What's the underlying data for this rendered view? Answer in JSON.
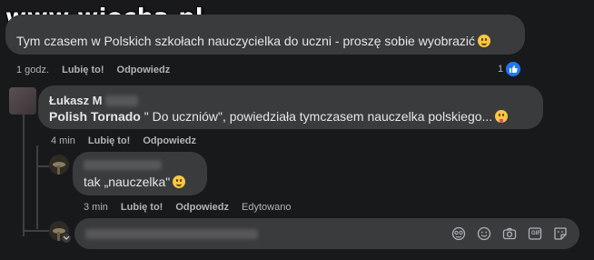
{
  "watermark": "www.wiocha.pl",
  "comment1": {
    "text": "Tym czasem w Polskich szkołach nauczycielka do uczni - proszę sobie wyobrazić",
    "emoji": "grinning-squinting-face",
    "time": "1 godz.",
    "like_label": "Lubię to!",
    "reply_label": "Odpowiedz",
    "reaction_count": "1"
  },
  "comment2": {
    "author": "Łukasz M",
    "mention": "Polish Tornado",
    "text": " \" Do uczniów\", powiedziała tymczasem nauczelka polskiego...",
    "emoji": "face-with-tongue",
    "time": "4 min",
    "like_label": "Lubię to!",
    "reply_label": "Odpowiedz"
  },
  "comment3": {
    "text": "tak „nauczelka\"",
    "emoji": "smiling-face",
    "time": "3 min",
    "like_label": "Lubię to!",
    "reply_label": "Odpowiedz",
    "edited_label": "Edytowano"
  },
  "reply_box": {
    "icons": [
      "sticker-icon",
      "emoji-icon",
      "camera-icon",
      "gif-icon",
      "sticker-sheet-icon"
    ],
    "gif_label": "GIF"
  },
  "colors": {
    "background": "#18191a",
    "bubble": "#3a3b3c",
    "text": "#e4e6eb",
    "secondary": "#b0b3b8",
    "like_blue": "#2078f4"
  }
}
